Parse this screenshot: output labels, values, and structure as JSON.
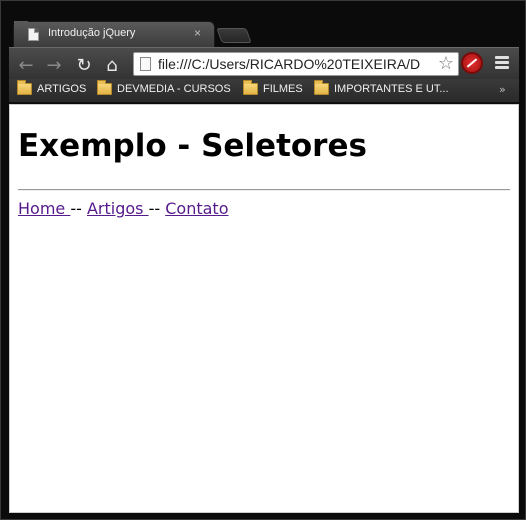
{
  "browser": {
    "tab": {
      "title": "Introdução jQuery",
      "close": "×"
    },
    "toolbar": {
      "back": "←",
      "forward": "→",
      "reload": "↻",
      "home": "⌂",
      "url": "file:///C:/Users/RICARDO%20TEIXEIRA/D",
      "star": "☆"
    },
    "bookmarks": [
      {
        "label": "ARTIGOS",
        "icon": "folder-icon"
      },
      {
        "label": "DEVMEDIA - CURSOS",
        "icon": "folder-icon"
      },
      {
        "label": "FILMES",
        "icon": "folder-icon"
      },
      {
        "label": "IMPORTANTES E UT...",
        "icon": "folder-icon"
      }
    ],
    "bookmarks_more": "»"
  },
  "page": {
    "heading": "Exemplo - Seletores",
    "links": [
      "Home ",
      "Artigos ",
      "Contato"
    ],
    "separator": "-- "
  },
  "colors": {
    "link_visited": "#551a8b",
    "chrome_dark": "#333333"
  }
}
